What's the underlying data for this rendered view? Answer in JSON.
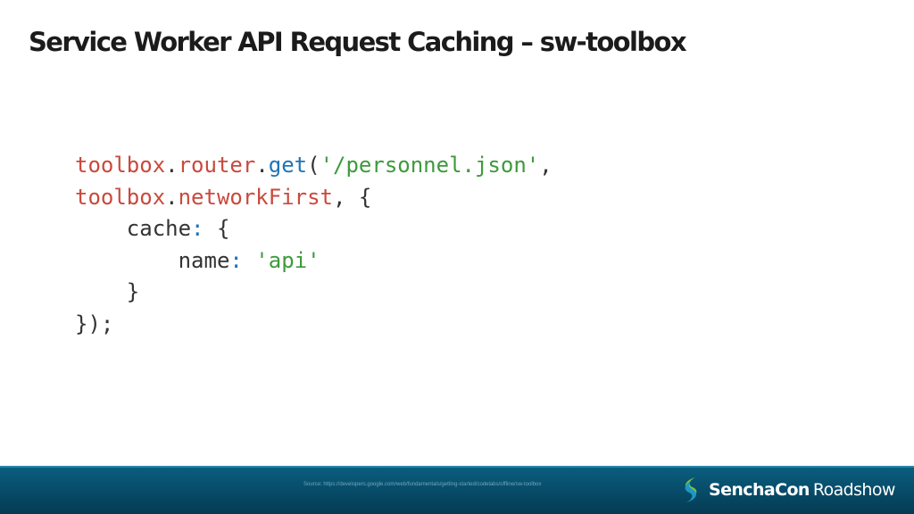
{
  "slide": {
    "title": "Service Worker API Request Caching – sw-toolbox"
  },
  "code": {
    "line1": {
      "obj": "toolbox",
      "dot1": ".",
      "prop": "router",
      "dot2": ".",
      "method": "get",
      "open": "(",
      "string": "'/personnel.json'",
      "comma": ","
    },
    "line2": {
      "obj": "toolbox",
      "dot": ".",
      "prop": "networkFirst",
      "rest": ", {"
    },
    "line3": {
      "indent": "    ",
      "key": "cache",
      "colon": ":",
      "rest": " {"
    },
    "line4": {
      "indent": "        ",
      "key": "name",
      "colon": ":",
      "space": " ",
      "string": "'api'"
    },
    "line5": {
      "text": "    }"
    },
    "line6": {
      "text": "});"
    }
  },
  "footer": {
    "source": "Source: https://developers.google.com/web/fundamentals/getting-started/codelabs/offline/sw-toolbox",
    "brand_name": "SenchaCon",
    "brand_sub": "Roadshow",
    "logo_icon": "sencha-logo-icon",
    "colors": {
      "bar": "#074b68",
      "logo_green": "#7fc142",
      "logo_teal": "#1d97c4"
    }
  }
}
